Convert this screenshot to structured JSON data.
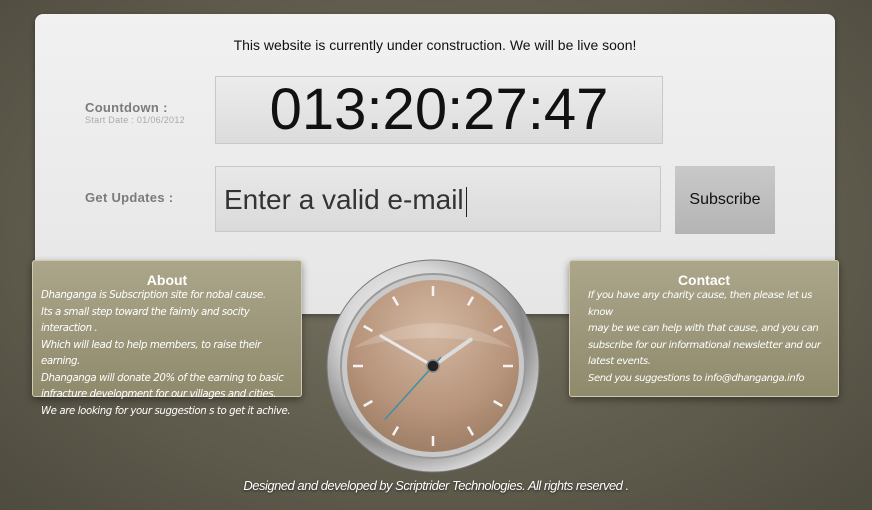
{
  "header": {
    "notice": "This website is currently under construction. We will be live soon!"
  },
  "countdown": {
    "label": "Countdown :",
    "start_date": "Start Date : 01/06/2012",
    "value": "013:20:27:47"
  },
  "updates": {
    "label": "Get Updates :",
    "email_value": "Enter a valid e-mail",
    "subscribe_label": "Subscribe"
  },
  "about": {
    "title": "About",
    "lines": [
      "Dhanganga is Subscription site for nobal cause.",
      "Its a small step toward the faimly and socity interaction .",
      "Which will lead to help members, to raise their earning.",
      "Dhanganga will donate 20% of the earning to basic",
      "infracture development for our villages and cities.",
      "We are looking for your suggestion s to get it achive."
    ]
  },
  "contact": {
    "title": "Contact",
    "lines": [
      "If you have any charity cause, then please let us know",
      "may be  we can help with that cause, and you can",
      "subscribe for our informational newsletter and our",
      "latest events.",
      "Send you suggestions to info@dhanganga.info"
    ]
  },
  "clock": {
    "hour": 1,
    "minute": 50,
    "second": 37,
    "colors": {
      "face": "#b8957c",
      "bezel": "#d8d8d8",
      "second_hand": "#3b8fa8"
    }
  },
  "footer": {
    "text": "Designed and developed by Scriptrider Technologies. All rights reserved ."
  }
}
